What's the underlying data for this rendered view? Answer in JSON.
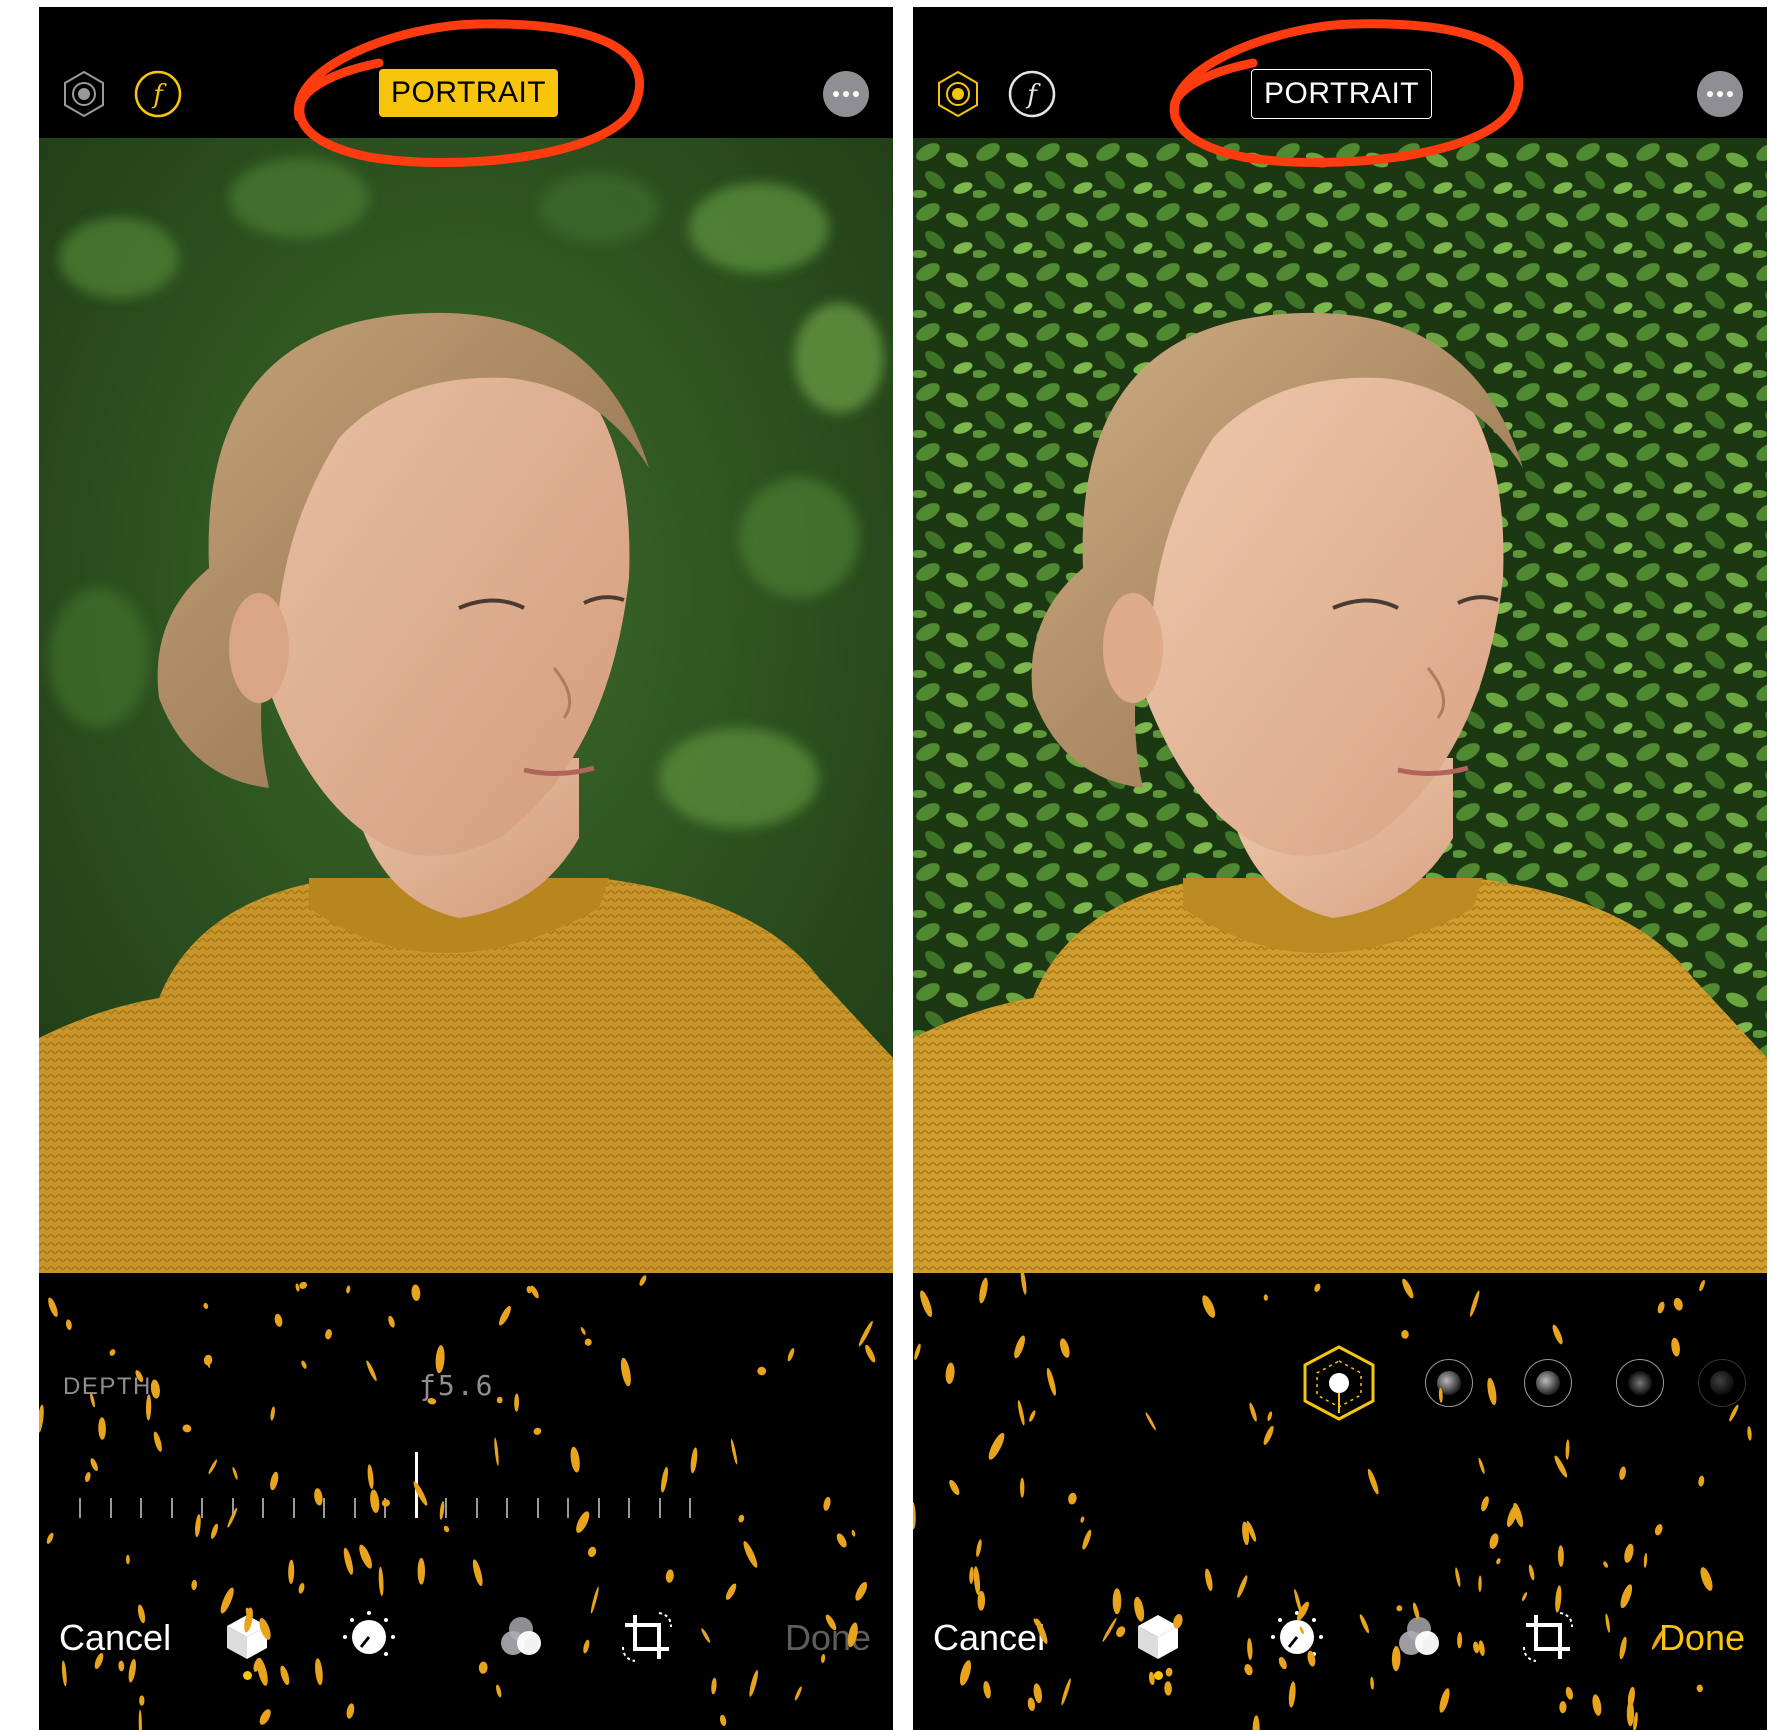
{
  "colors": {
    "accent": "#f7c50b",
    "annotation": "#ff3b10",
    "sweater": "#c8962a",
    "foliage": "#2e5a22"
  },
  "screens": [
    {
      "id": "left",
      "top_icons": [
        "live-photo-icon",
        "f-stop-icon",
        "more-icon"
      ],
      "portrait_label": "PORTRAIT",
      "portrait_active": true,
      "depth_label": "DEPTH",
      "depth_value": "ƒ5.6",
      "toolbar": {
        "cancel": "Cancel",
        "done": "Done",
        "done_enabled": false,
        "selected_tool": "portrait-cube-icon"
      }
    },
    {
      "id": "right",
      "top_icons": [
        "live-photo-icon",
        "f-stop-icon",
        "more-icon"
      ],
      "portrait_label": "PORTRAIT",
      "portrait_active": false,
      "lighting_options": [
        "natural-light-icon",
        "studio-light-icon",
        "contour-light-icon",
        "stage-light-icon",
        "stage-light-mono-icon"
      ],
      "toolbar": {
        "cancel": "Cancel",
        "done": "Done",
        "done_enabled": true,
        "selected_tool": "portrait-cube-icon"
      }
    }
  ]
}
